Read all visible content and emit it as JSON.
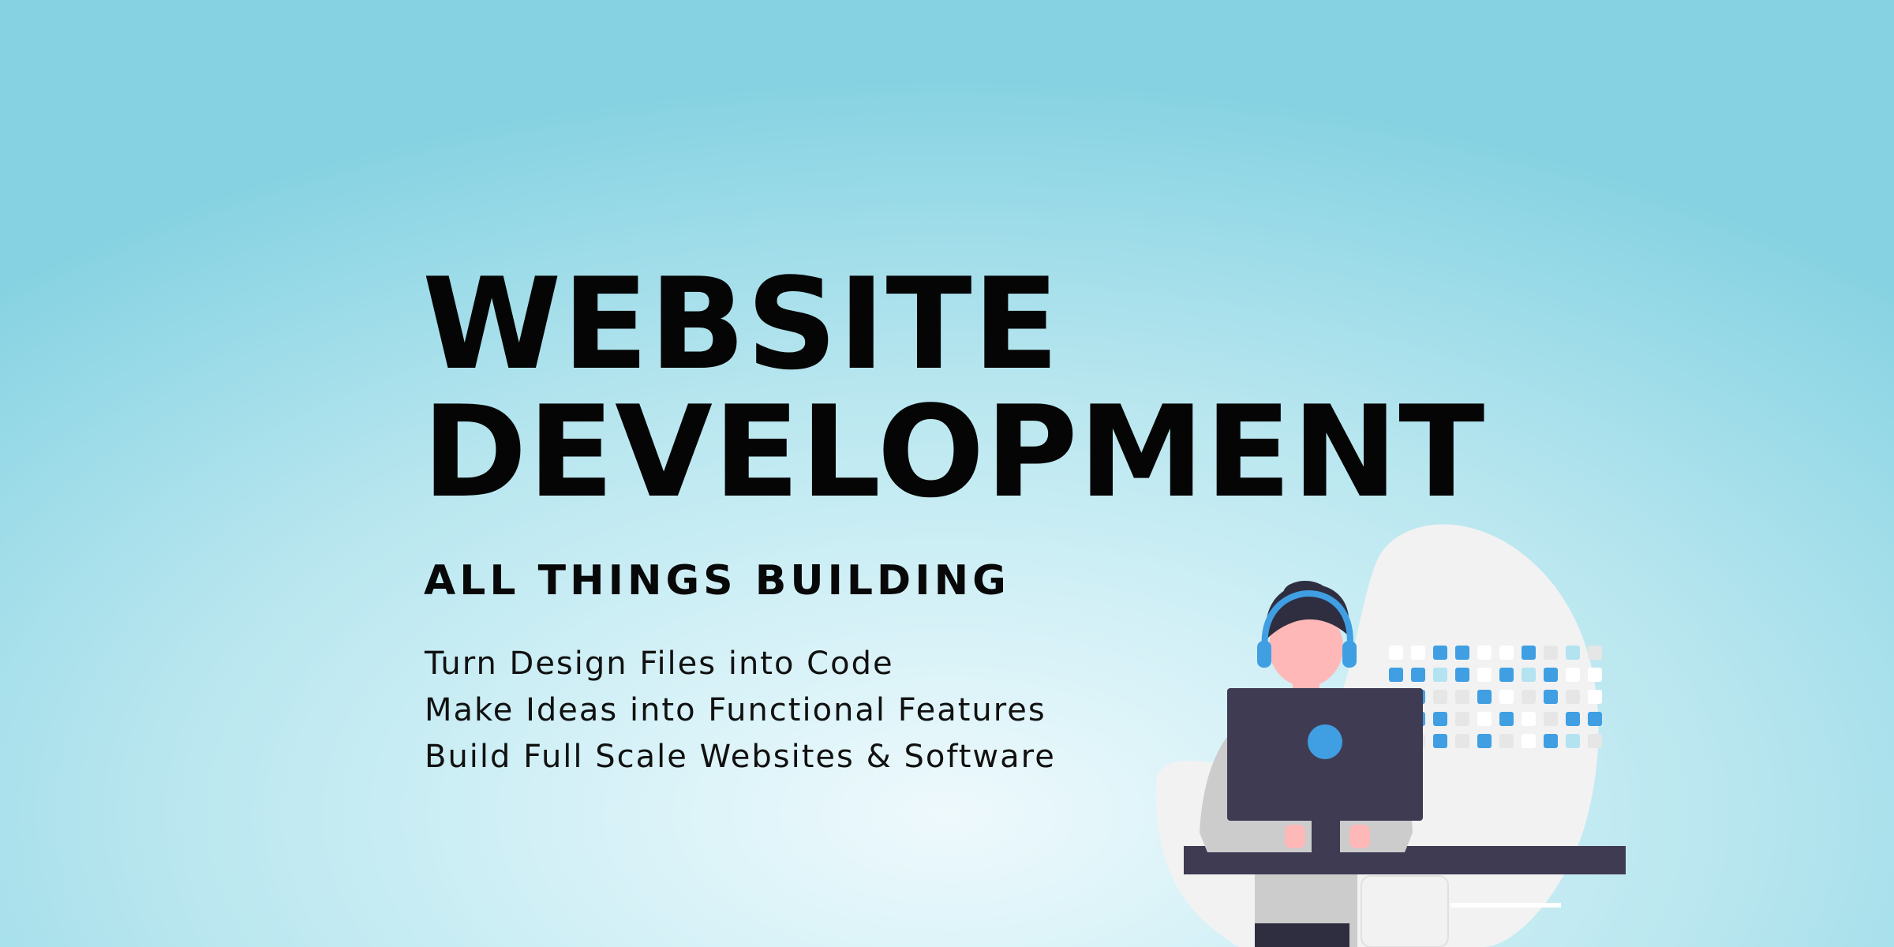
{
  "banner": {
    "headline_line1": "WEBSITE",
    "headline_line2": "DEVELOPMENT",
    "subtitle": "ALL THINGS BUILDING",
    "features": [
      "Turn Design Files into Code",
      "Make Ideas into Functional Features",
      "Build Full Scale Websites & Software"
    ],
    "colors": {
      "background_center": "#eef9fc",
      "background_edge": "#86d2e2",
      "headline_text": "#050505",
      "accent_blue": "#3f9fe2",
      "monitor": "#3f3b53",
      "blob": "#f2f2f2"
    },
    "illustration": {
      "icon": "developer-with-headset-at-computer-icon"
    }
  }
}
